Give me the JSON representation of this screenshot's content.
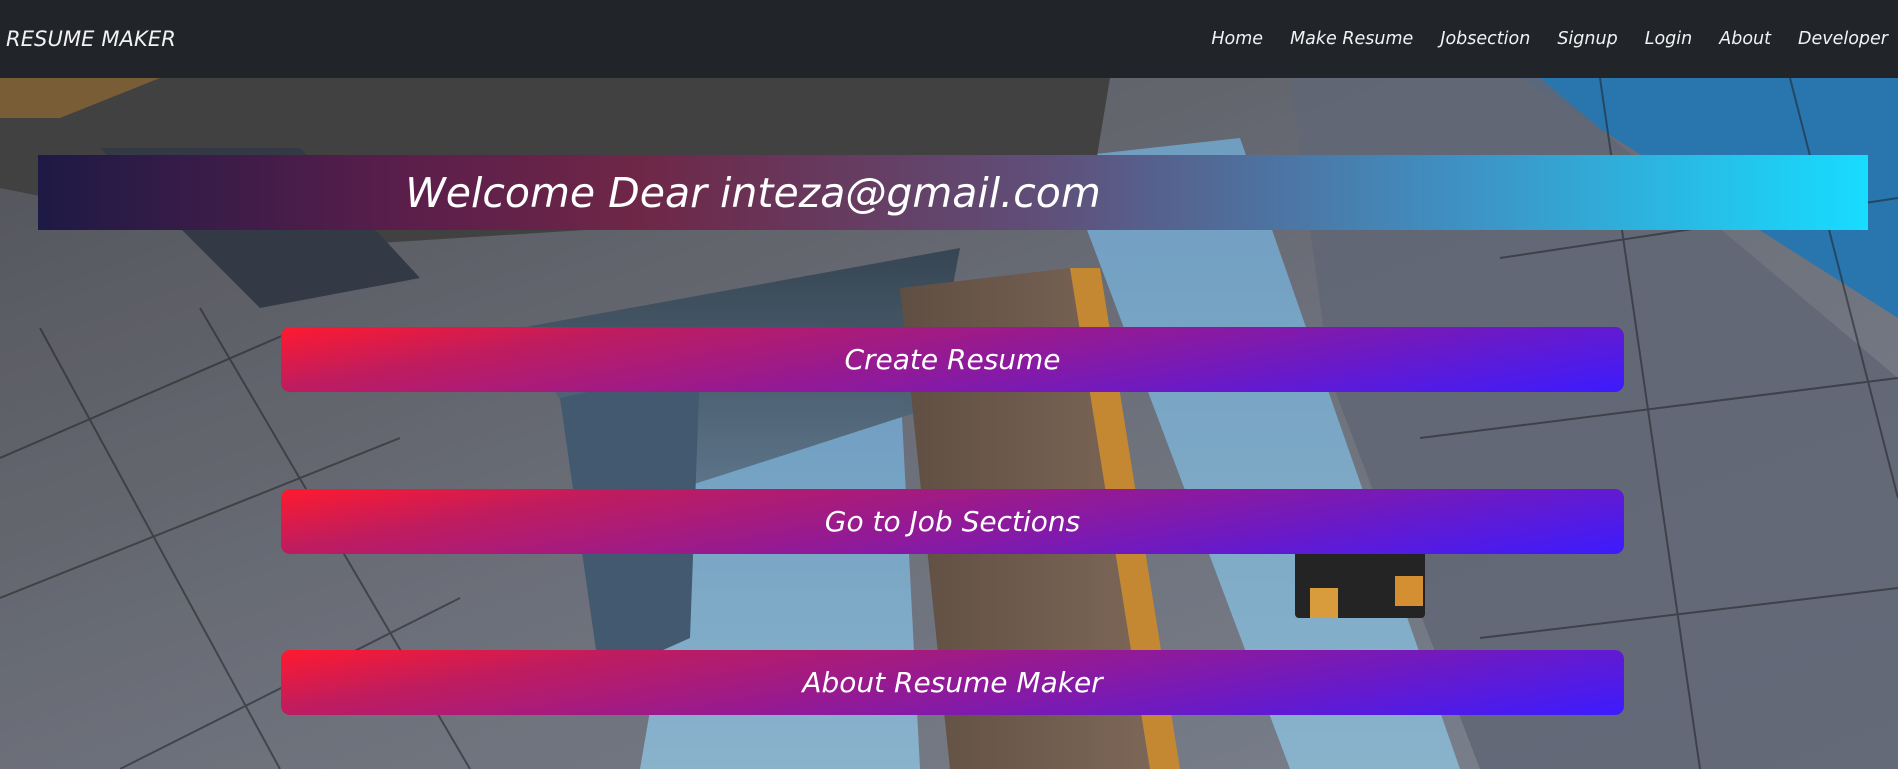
{
  "navbar": {
    "brand": "RESUME MAKER",
    "links": [
      {
        "label": "Home"
      },
      {
        "label": "Make Resume"
      },
      {
        "label": "Jobsection"
      },
      {
        "label": "Signup"
      },
      {
        "label": "Login"
      },
      {
        "label": "About"
      },
      {
        "label": "Developer"
      }
    ]
  },
  "welcome": {
    "text": "Welcome Dear inteza@gmail.com"
  },
  "actions": {
    "create_resume": "Create Resume",
    "job_sections": "Go to Job Sections",
    "about_resume_maker": "About Resume Maker"
  },
  "colors": {
    "navbar_bg": "#212529",
    "button_start": "#ff1a2e",
    "button_end": "#3c1bff",
    "banner_start": "#1d1a45",
    "banner_end": "#17dcff"
  }
}
